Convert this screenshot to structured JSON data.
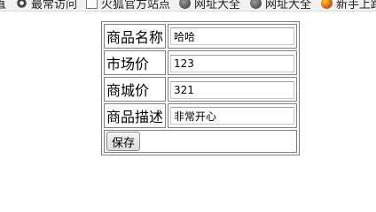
{
  "bookmarks": [
    {
      "label": "最常访问",
      "icon": "gear-icon"
    },
    {
      "label": "火狐官方站点",
      "icon": "page-icon"
    },
    {
      "label": "网址大全",
      "icon": "globe-icon"
    },
    {
      "label": "网址大全",
      "icon": "globe-icon"
    },
    {
      "label": "新手上路",
      "icon": "firefox-icon"
    }
  ],
  "form": {
    "rows": [
      {
        "label": "商品名称",
        "value": "哈哈"
      },
      {
        "label": "市场价",
        "value": "123"
      },
      {
        "label": "商城价",
        "value": "321"
      },
      {
        "label": "商品描述",
        "value": "非常开心"
      }
    ],
    "save_label": "保存"
  }
}
